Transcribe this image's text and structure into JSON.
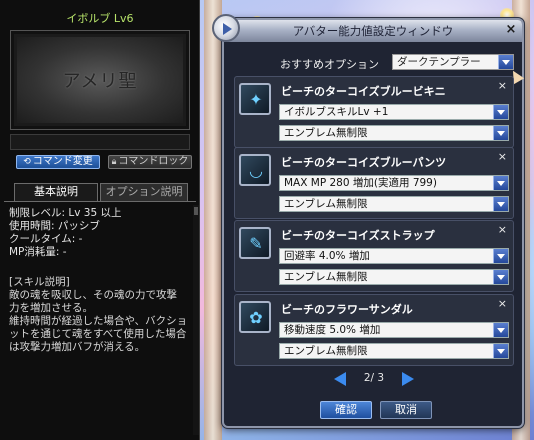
{
  "skill_panel": {
    "title": "イボルブ Lv6",
    "image_logo": "アメリ聖",
    "btn_command_change": "コマンド変更",
    "btn_command_lock": "コマンドロック",
    "tab_basic": "基本説明",
    "tab_option": "オプション説明",
    "info": [
      "制限レベル: Lv 35 以上",
      "使用時間: パッシブ",
      "クールタイム: -",
      "MP消耗量: -"
    ],
    "desc": [
      "[スキル説明]",
      "敵の魂を吸収し、その魂の力で攻撃",
      "力を増加させる。",
      "維持時間が経過した場合や、バクショ",
      "ットを通じて魂をすべて使用した場合",
      "は攻撃力増加バフが消える。"
    ]
  },
  "avatar_window": {
    "title": "アバター能力値設定ウィンドウ",
    "close": "×",
    "recommend_label": "おすすめオプション",
    "recommend_value": "ダークテンプラー",
    "items": [
      {
        "name": "ビーチのターコイズブルービキニ",
        "option": "イボルブスキルLv +1",
        "emblem": "エンブレム無制限",
        "icon": "bikini-top-icon",
        "glyph": "✦"
      },
      {
        "name": "ビーチのターコイズブルーパンツ",
        "option": "MAX MP 280 増加(実適用 799)",
        "emblem": "エンブレム無制限",
        "icon": "bikini-pants-icon",
        "glyph": "◡"
      },
      {
        "name": "ビーチのターコイズストラップ",
        "option": "回避率 4.0% 増加",
        "emblem": "エンブレム無制限",
        "icon": "strap-icon",
        "glyph": "✎"
      },
      {
        "name": "ビーチのフラワーサンダル",
        "option": "移動速度 5.0% 増加",
        "emblem": "エンブレム無制限",
        "icon": "sandal-icon",
        "glyph": "✿"
      }
    ],
    "item_close": "×",
    "pager": "2/ 3",
    "btn_ok": "確認",
    "btn_cancel": "取消"
  }
}
